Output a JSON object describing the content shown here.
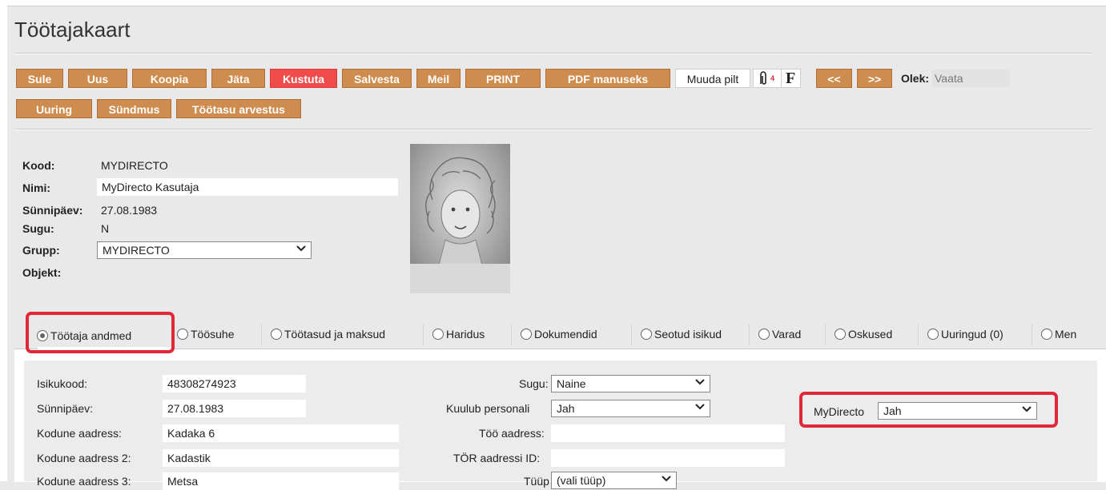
{
  "title": "Töötajakaart",
  "toolbar": {
    "row1": [
      "Sule",
      "Uus",
      "Koopia",
      "Jäta",
      "Kustuta",
      "Salvesta",
      "Meil",
      "PRINT",
      "PDF manuseks"
    ],
    "muuda_pilt": "Muuda pilt",
    "attach_count": "4",
    "f_label": "F",
    "prev": "<<",
    "next": ">>",
    "olek_label": "Olek:",
    "olek_value": "Vaata",
    "row2": [
      "Uuring",
      "Sündmus",
      "Töötasu arvestus"
    ],
    "colors": {
      "button": "#cf8c4f",
      "delete": "#f04c4c"
    }
  },
  "header": {
    "kood_label": "Kood:",
    "kood_value": "MYDIRECTO",
    "nimi_label": "Nimi:",
    "nimi_value": "MyDirecto Kasutaja",
    "synnipaev_label": "Sünnipäev:",
    "synnipaev_value": "27.08.1983",
    "sugu_label": "Sugu:",
    "sugu_value": "N",
    "grupp_label": "Grupp:",
    "grupp_value": "MYDIRECTO",
    "objekt_label": "Objekt:"
  },
  "tabs": [
    {
      "label": "Töötaja andmed",
      "selected": true
    },
    {
      "label": "Töösuhe",
      "selected": false
    },
    {
      "label": "Töötasud ja maksud",
      "selected": false
    },
    {
      "label": "Haridus",
      "selected": false
    },
    {
      "label": "Dokumendid",
      "selected": false
    },
    {
      "label": "Seotud isikud",
      "selected": false
    },
    {
      "label": "Varad",
      "selected": false
    },
    {
      "label": "Oskused",
      "selected": false
    },
    {
      "label": "Uuringud (0)",
      "selected": false
    },
    {
      "label": "Men",
      "selected": false
    }
  ],
  "form": {
    "isikukood_label": "Isikukood:",
    "isikukood_value": "48308274923",
    "synnipaev_label": "Sünnipäev:",
    "synnipaev_value": "27.08.1983",
    "aadress1_label": "Kodune aadress:",
    "aadress1_value": "Kadaka 6",
    "aadress2_label": "Kodune aadress 2:",
    "aadress2_value": "Kadastik",
    "aadress3_label": "Kodune aadress 3:",
    "aadress3_value": "Metsa",
    "sugu_label": "Sugu:",
    "sugu_value": "Naine",
    "personal_label": "Kuulub personali",
    "personal_value": "Jah",
    "too_aadress_label": "Töö aadress:",
    "too_aadress_value": "",
    "tor_label": "TÖR aadressi ID:",
    "tor_value": "",
    "tyyp_label": "Tüüp",
    "tyyp_value": "(vali tüüp)",
    "mydirecto_label": "MyDirecto",
    "mydirecto_value": "Jah"
  },
  "highlight_color": "#e0283a"
}
